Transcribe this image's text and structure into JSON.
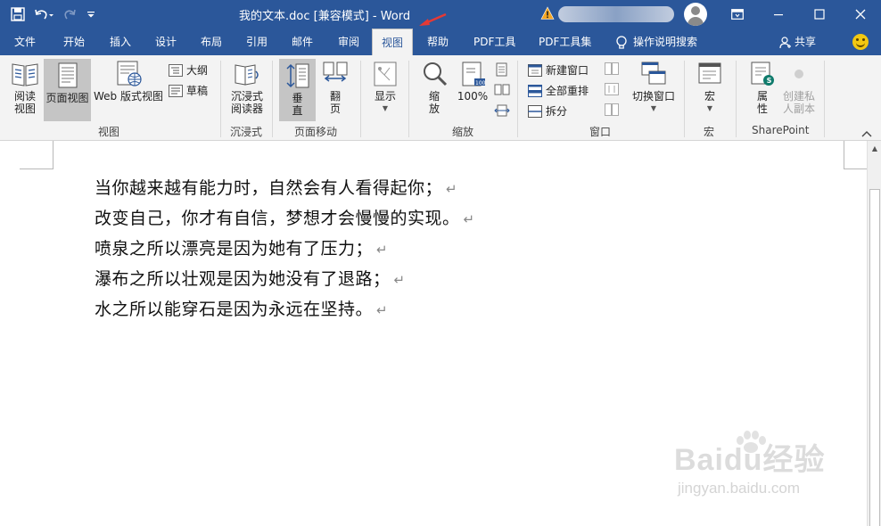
{
  "titlebar": {
    "title": "我的文本.doc [兼容模式]  -  Word",
    "qat_icons": [
      "save-icon",
      "undo-icon",
      "redo-icon",
      "customize-qat-icon"
    ],
    "controls": [
      "ribbon-display-icon",
      "minimize-icon",
      "maximize-icon",
      "close-icon"
    ]
  },
  "tabs": {
    "items": [
      "文件",
      "开始",
      "插入",
      "设计",
      "布局",
      "引用",
      "邮件",
      "审阅",
      "视图",
      "帮助",
      "PDF工具",
      "PDF工具集"
    ],
    "active": "视图",
    "tell_me": "操作说明搜索",
    "share": "共享"
  },
  "ribbon": {
    "views": {
      "read_mode": "阅读\n视图",
      "print_layout": "页面视图",
      "web_layout": "Web 版式视图",
      "outline": "大纲",
      "draft": "草稿",
      "label": "视图"
    },
    "immersive": {
      "reader": "沉浸式\n阅读器",
      "label": "沉浸式"
    },
    "page_movement": {
      "vertical": "垂\n直",
      "side_to_side": "翻\n页",
      "label": "页面移动"
    },
    "show": {
      "show": "显示"
    },
    "zoom": {
      "zoom": "缩\n放",
      "hundred": "100%",
      "label": "缩放"
    },
    "window": {
      "new_window": "新建窗口",
      "arrange_all": "全部重排",
      "split": "拆分",
      "switch_windows": "切换窗口",
      "label": "窗口"
    },
    "macros": {
      "macros": "宏",
      "label": "宏"
    },
    "sharepoint": {
      "properties": "属\n性",
      "private_copy": "创建私\n人副本",
      "label": "SharePoint"
    }
  },
  "document": {
    "lines": [
      "当你越来越有能力时，自然会有人看得起你；",
      "改变自己，你才有自信，梦想才会慢慢的实现。",
      "喷泉之所以漂亮是因为她有了压力；",
      "瀑布之所以壮观是因为她没有了退路；",
      "水之所以能穿石是因为永远在坚持。"
    ],
    "paragraph_mark": "↵"
  },
  "watermark": {
    "main": "Baidu经验",
    "sub": "jingyan.baidu.com"
  },
  "colors": {
    "accent": "#2b579a",
    "ribbon_bg": "#f3f3f3",
    "selected": "#c5c5c5",
    "annotation_arrow": "#e53935"
  }
}
